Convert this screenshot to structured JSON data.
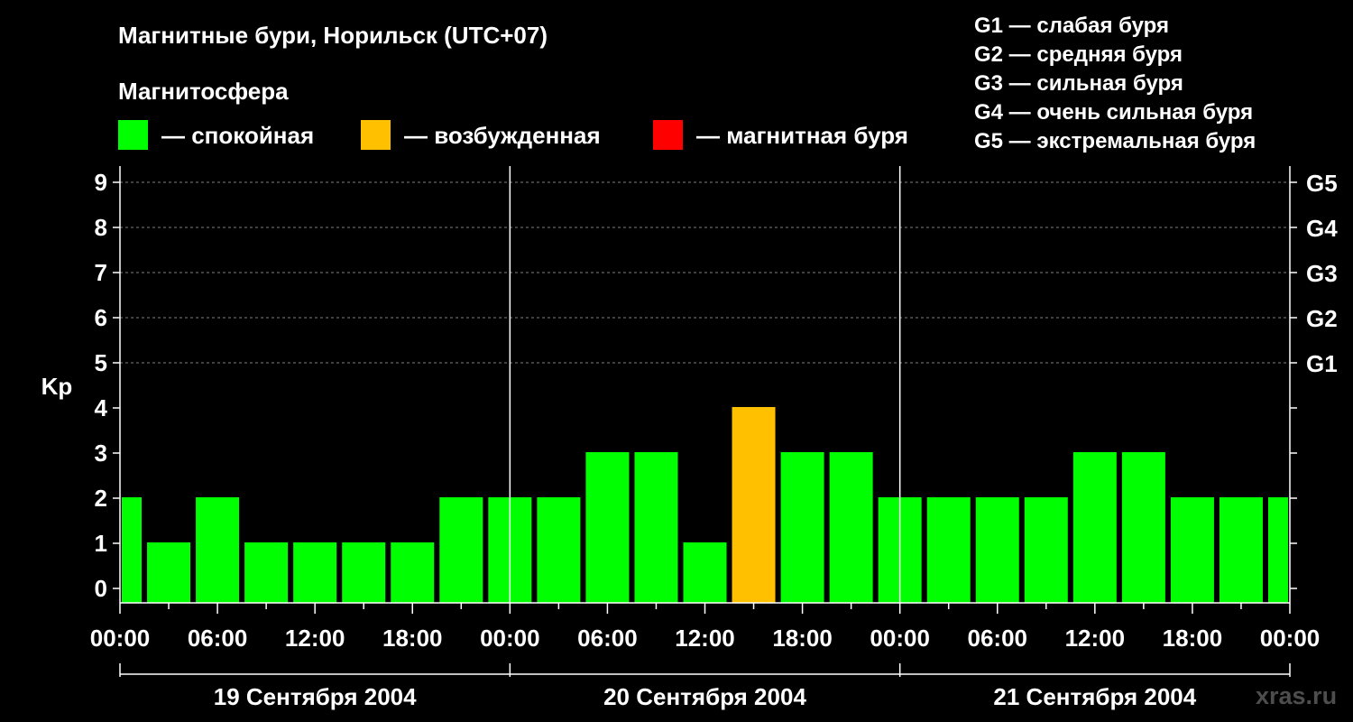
{
  "title": "Магнитные бури, Норильск (UTC+07)",
  "legend": {
    "title": "Магнитосфера",
    "items": [
      {
        "label": "— спокойная",
        "color": "#00ff00"
      },
      {
        "label": "— возбужденная",
        "color": "#ffc000"
      },
      {
        "label": "— магнитная буря",
        "color": "#ff0000"
      }
    ]
  },
  "g_legend": [
    "G1 — слабая буря",
    "G2 — средняя буря",
    "G3 — сильная буря",
    "G4 — очень сильная буря",
    "G5 — экстремальная буря"
  ],
  "watermark": "xras.ru",
  "colors": {
    "quiet": "#00ff00",
    "disturbed": "#ffc000",
    "storm": "#ff0000",
    "grid": "#808080",
    "axis": "#ffffff"
  },
  "chart_data": {
    "type": "bar",
    "ylabel": "Kp",
    "ylim": [
      0,
      9
    ],
    "y_ticks": [
      0,
      1,
      2,
      3,
      4,
      5,
      6,
      7,
      8,
      9
    ],
    "right_ticks": [
      {
        "value": 5,
        "label": "G1"
      },
      {
        "value": 6,
        "label": "G2"
      },
      {
        "value": 7,
        "label": "G3"
      },
      {
        "value": 8,
        "label": "G4"
      },
      {
        "value": 9,
        "label": "G5"
      }
    ],
    "x_tick_labels": [
      "00:00",
      "06:00",
      "12:00",
      "18:00",
      "00:00",
      "06:00",
      "12:00",
      "18:00",
      "00:00",
      "06:00",
      "12:00",
      "18:00",
      "00:00"
    ],
    "days": [
      "19 Сентября 2004",
      "20 Сентября 2004",
      "21 Сентября 2004"
    ],
    "bars": [
      {
        "time": "19.09 00:00",
        "kp": 2,
        "status": "quiet"
      },
      {
        "time": "19.09 03:00",
        "kp": 1,
        "status": "quiet"
      },
      {
        "time": "19.09 06:00",
        "kp": 2,
        "status": "quiet"
      },
      {
        "time": "19.09 09:00",
        "kp": 1,
        "status": "quiet"
      },
      {
        "time": "19.09 12:00",
        "kp": 1,
        "status": "quiet"
      },
      {
        "time": "19.09 15:00",
        "kp": 1,
        "status": "quiet"
      },
      {
        "time": "19.09 18:00",
        "kp": 1,
        "status": "quiet"
      },
      {
        "time": "19.09 21:00",
        "kp": 2,
        "status": "quiet"
      },
      {
        "time": "20.09 00:00",
        "kp": 2,
        "status": "quiet"
      },
      {
        "time": "20.09 03:00",
        "kp": 2,
        "status": "quiet"
      },
      {
        "time": "20.09 06:00",
        "kp": 3,
        "status": "quiet"
      },
      {
        "time": "20.09 09:00",
        "kp": 3,
        "status": "quiet"
      },
      {
        "time": "20.09 12:00",
        "kp": 1,
        "status": "quiet"
      },
      {
        "time": "20.09 15:00",
        "kp": 4,
        "status": "disturbed"
      },
      {
        "time": "20.09 18:00",
        "kp": 3,
        "status": "quiet"
      },
      {
        "time": "20.09 21:00",
        "kp": 3,
        "status": "quiet"
      },
      {
        "time": "21.09 00:00",
        "kp": 2,
        "status": "quiet"
      },
      {
        "time": "21.09 03:00",
        "kp": 2,
        "status": "quiet"
      },
      {
        "time": "21.09 06:00",
        "kp": 2,
        "status": "quiet"
      },
      {
        "time": "21.09 09:00",
        "kp": 2,
        "status": "quiet"
      },
      {
        "time": "21.09 12:00",
        "kp": 3,
        "status": "quiet"
      },
      {
        "time": "21.09 15:00",
        "kp": 3,
        "status": "quiet"
      },
      {
        "time": "21.09 18:00",
        "kp": 2,
        "status": "quiet"
      },
      {
        "time": "21.09 21:00",
        "kp": 2,
        "status": "quiet"
      },
      {
        "time": "22.09 00:00",
        "kp": 2,
        "status": "quiet"
      }
    ],
    "grid": true
  }
}
